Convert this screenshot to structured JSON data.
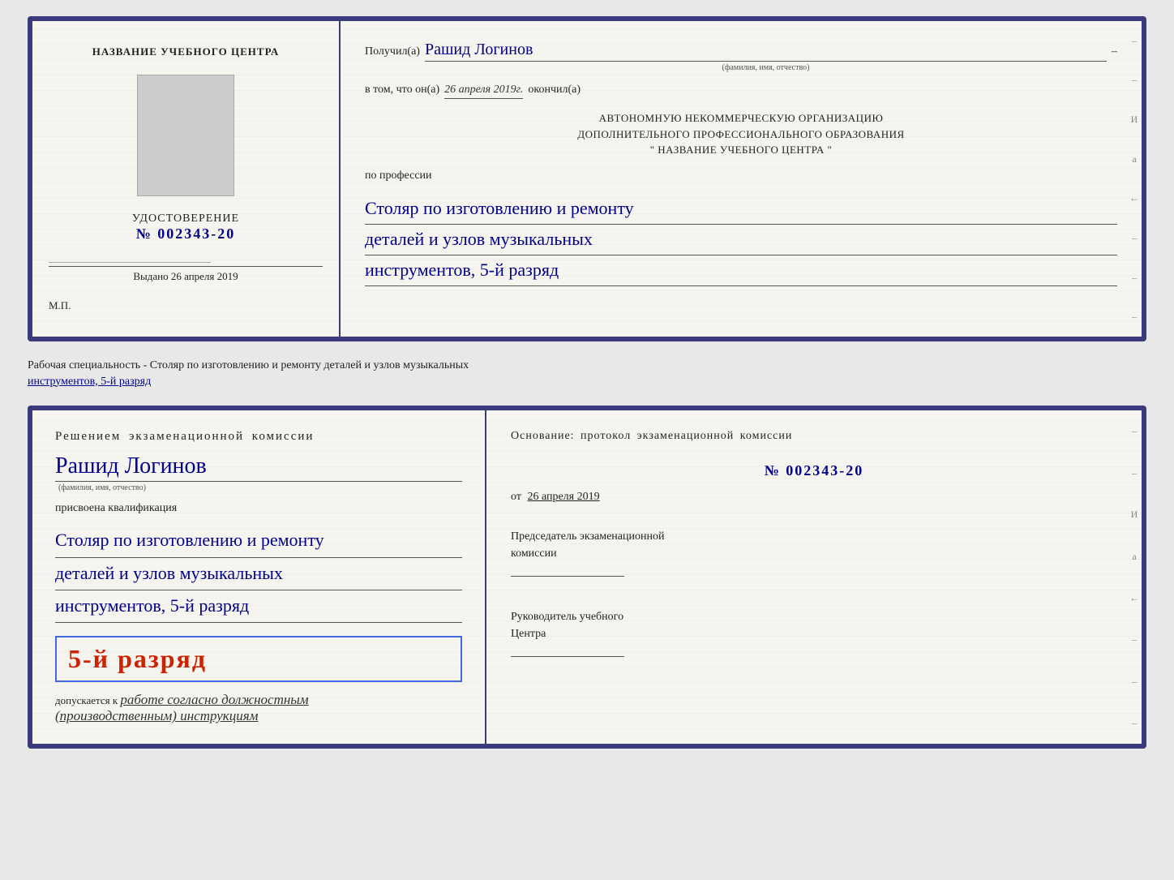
{
  "top_cert": {
    "left": {
      "center_title": "НАЗВАНИЕ УЧЕБНОГО ЦЕНТРА",
      "udostoverenie_label": "УДОСТОВЕРЕНИЕ",
      "number": "№ 002343-20",
      "vydano_label": "Выдано",
      "vydano_date": "26 апреля 2019",
      "mp": "М.П."
    },
    "right": {
      "poluchil_label": "Получил(а)",
      "recipient_name": "Рашид Логинов",
      "fio_sublabel": "(фамилия, имя, отчество)",
      "dash": "–",
      "vtom_label": "в том, что он(а)",
      "date_italic": "26 апреля 2019г.",
      "okonchil_label": "окончил(а)",
      "org_line1": "АВТОНОМНУЮ НЕКОММЕРЧЕСКУЮ ОРГАНИЗАЦИЮ",
      "org_line2": "ДОПОЛНИТЕЛЬНОГО ПРОФЕССИОНАЛЬНОГО ОБРАЗОВАНИЯ",
      "org_line3": "\"    НАЗВАНИЕ УЧЕБНОГО ЦЕНТРА    \"",
      "po_professii": "по профессии",
      "profession_line1": "Столяр по изготовлению и ремонту",
      "profession_line2": "деталей и узлов музыкальных",
      "profession_line3": "инструментов, 5-й разряд"
    }
  },
  "separator": {
    "text": "Рабочая специальность - Столяр по изготовлению и ремонту деталей и узлов музыкальных",
    "text2": "инструментов, 5-й разряд"
  },
  "bottom_cert": {
    "left": {
      "resheniem_label": "Решением  экзаменационной  комиссии",
      "person_name": "Рашид Логинов",
      "fio_sublabel": "(фамилия, имя, отчество)",
      "prisvoena_label": "присвоена квалификация",
      "qual_line1": "Столяр по изготовлению и ремонту",
      "qual_line2": "деталей и узлов музыкальных",
      "qual_line3": "инструментов, 5-й разряд",
      "grade_text": "5-й разряд",
      "dopuskaetsya_label": "допускается к",
      "dopuskaetsya_text": "работе согласно должностным",
      "dopuskaetsya_text2": "(производственным) инструкциям"
    },
    "right": {
      "osnov_label": "Основание: протокол экзаменационной  комиссии",
      "protocol_number": "№  002343-20",
      "ot_label": "от",
      "ot_date": "26 апреля 2019",
      "predsedatel_label": "Председатель экзаменационной",
      "predsedatel_label2": "комиссии",
      "rukovoditel_label": "Руководитель учебного",
      "rukovoditel_label2": "Центра"
    }
  },
  "side_marks": {
    "items": [
      "И",
      "а",
      "←",
      "–",
      "–",
      "–",
      "–"
    ]
  }
}
